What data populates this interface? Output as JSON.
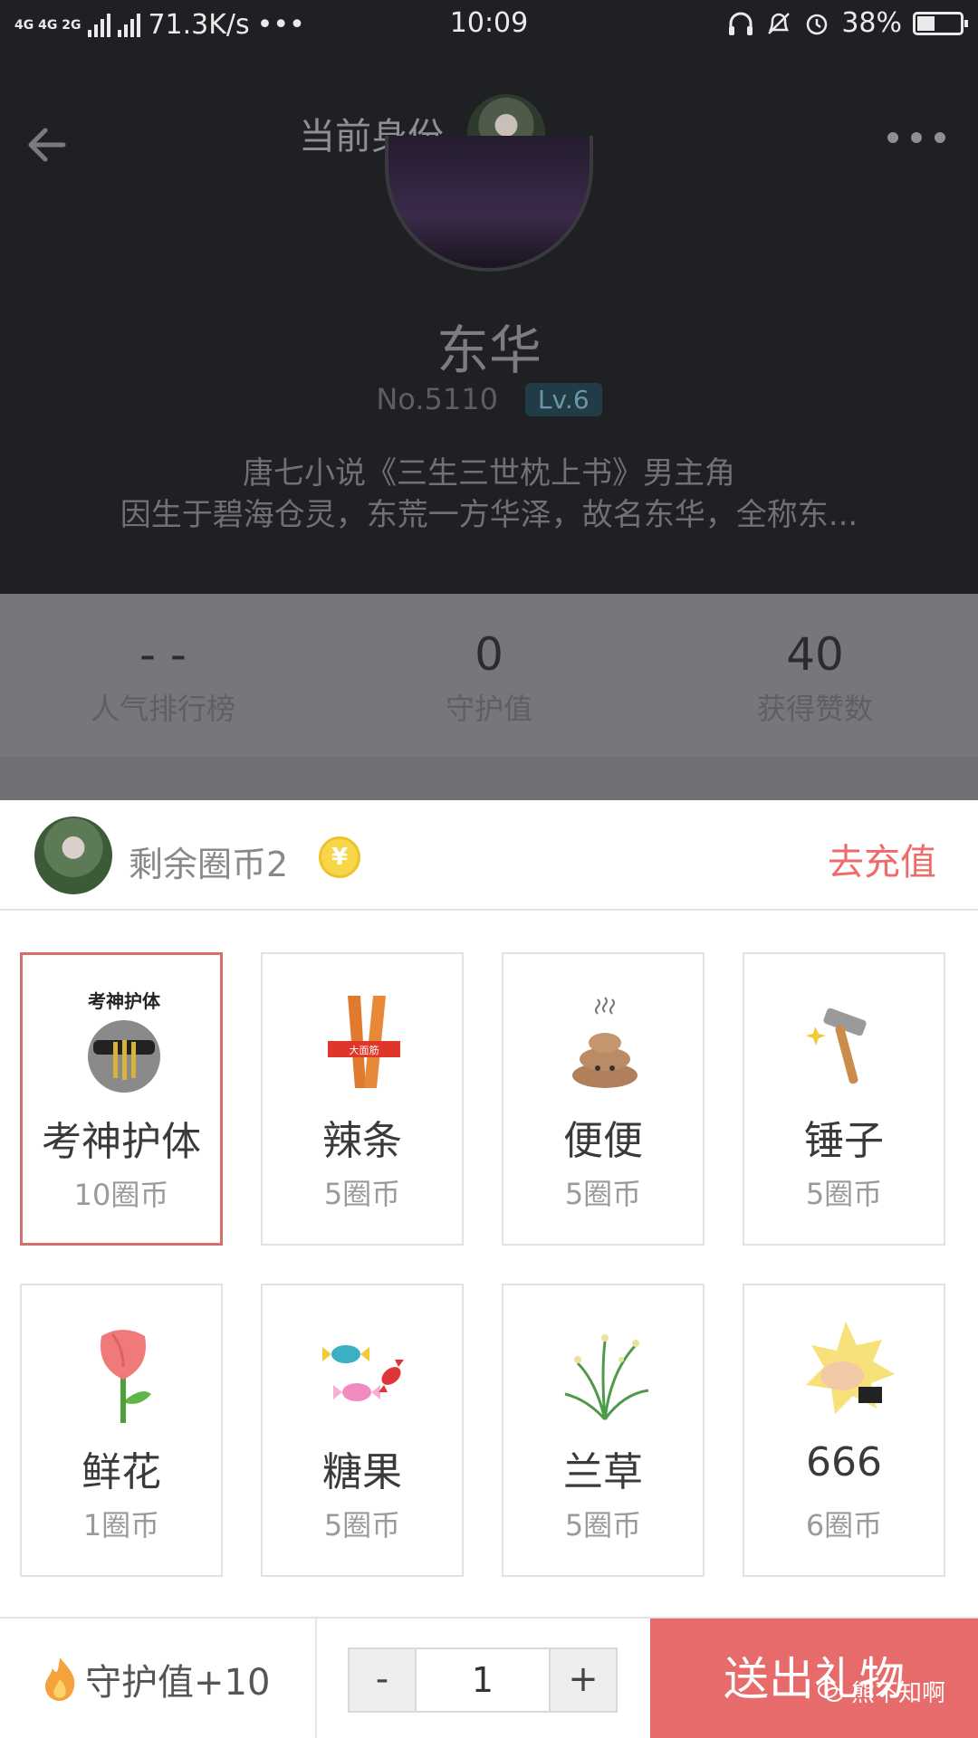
{
  "status_bar": {
    "network": "4G 4G 2G",
    "speed": "71.3K/s",
    "dots": "•••",
    "time": "10:09",
    "battery": "38%",
    "battery_level": 0.38
  },
  "header": {
    "title": "当前身份"
  },
  "profile": {
    "name": "东华",
    "number": "No.5110",
    "level": "Lv.6",
    "description_line1": "唐七小说《三生三世枕上书》男主角",
    "description_line2": "因生于碧海仓灵，东荒一方华泽，故名东华，全称东..."
  },
  "stats": [
    {
      "value": "- -",
      "label": "人气排行榜"
    },
    {
      "value": "0",
      "label": "守护值"
    },
    {
      "value": "40",
      "label": "获得赞数"
    }
  ],
  "coins": {
    "label": "剩余圈币2",
    "coin_symbol": "¥",
    "recharge": "去充值"
  },
  "gifts": [
    {
      "name": "考神护体",
      "price": "10圈币",
      "icon": "exam-god-icon",
      "selected": true,
      "art_text": "考神护体"
    },
    {
      "name": "辣条",
      "price": "5圈币",
      "icon": "spicy-strip-icon",
      "selected": false,
      "art_text": "大面筋"
    },
    {
      "name": "便便",
      "price": "5圈币",
      "icon": "poop-icon",
      "selected": false
    },
    {
      "name": "锤子",
      "price": "5圈币",
      "icon": "hammer-icon",
      "selected": false
    },
    {
      "name": "鲜花",
      "price": "1圈币",
      "icon": "flower-icon",
      "selected": false
    },
    {
      "name": "糖果",
      "price": "5圈币",
      "icon": "candy-icon",
      "selected": false
    },
    {
      "name": "兰草",
      "price": "5圈币",
      "icon": "orchid-icon",
      "selected": false
    },
    {
      "name": "666",
      "price": "6圈币",
      "icon": "six-hand-icon",
      "selected": false
    }
  ],
  "bottom": {
    "guard": "守护值+10",
    "minus": "-",
    "quantity": "1",
    "plus": "+",
    "send": "送出礼物"
  },
  "watermark": "熊不知啊",
  "colors": {
    "accent": "#e86b6b",
    "recharge": "#ef6a68",
    "selected_border": "#d6706f",
    "level_badge": "#223c47"
  }
}
